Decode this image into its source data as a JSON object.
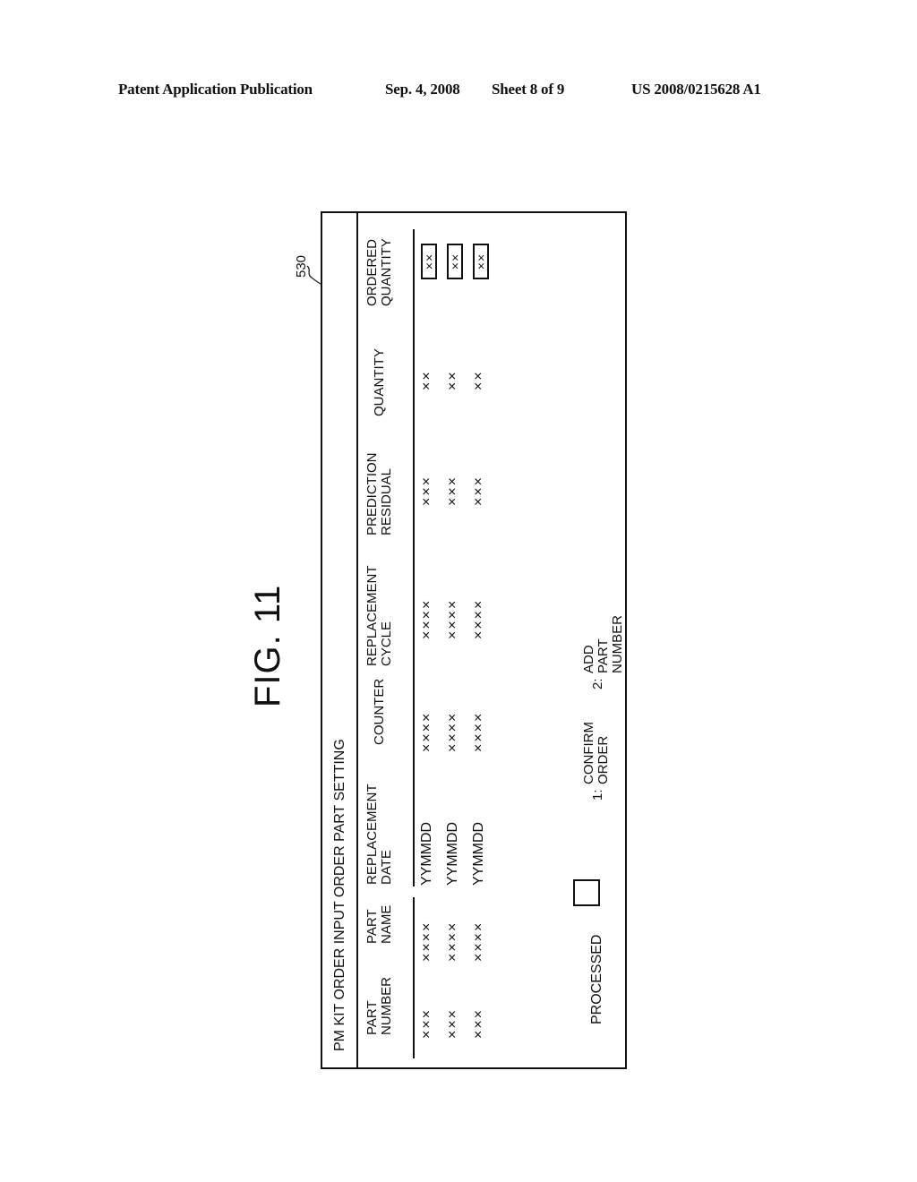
{
  "header": {
    "publication": "Patent Application Publication",
    "date": "Sep. 4, 2008",
    "sheet": "Sheet 8 of 9",
    "number": "US 2008/0215628 A1"
  },
  "figure": {
    "label": "FIG. 11",
    "reference": "530"
  },
  "screen": {
    "title": "PM KIT ORDER INPUT ORDER PART SETTING",
    "columns": [
      {
        "label": "PART\nNUMBER"
      },
      {
        "label": "PART\nNAME"
      },
      {
        "label": "REPLACEMENT\nDATE"
      },
      {
        "label": "COUNTER"
      },
      {
        "label": "REPLACEMENT\nCYCLE"
      },
      {
        "label": "PREDICTION\nRESIDUAL"
      },
      {
        "label": "QUANTITY"
      },
      {
        "label": "ORDERED\nQUANTITY"
      }
    ],
    "rows": [
      {
        "part_number": "×××",
        "part_name": "××××",
        "replacement_date": "YYMMDD",
        "counter": "××××",
        "replacement_cycle": "××××",
        "prediction_residual": "×××",
        "quantity": "××",
        "ordered_quantity": "××"
      },
      {
        "part_number": "×××",
        "part_name": "××××",
        "replacement_date": "YYMMDD",
        "counter": "××××",
        "replacement_cycle": "××××",
        "prediction_residual": "×××",
        "quantity": "××",
        "ordered_quantity": "××"
      },
      {
        "part_number": "×××",
        "part_name": "××××",
        "replacement_date": "YYMMDD",
        "counter": "××××",
        "replacement_cycle": "××××",
        "prediction_residual": "×××",
        "quantity": "××",
        "ordered_quantity": "××"
      }
    ],
    "processed_label": "PROCESSED",
    "buttons": [
      {
        "num": "1:",
        "label": "CONFIRM\nORDER"
      },
      {
        "num": "2:",
        "label": "ADD PART\nNUMBER"
      }
    ]
  }
}
